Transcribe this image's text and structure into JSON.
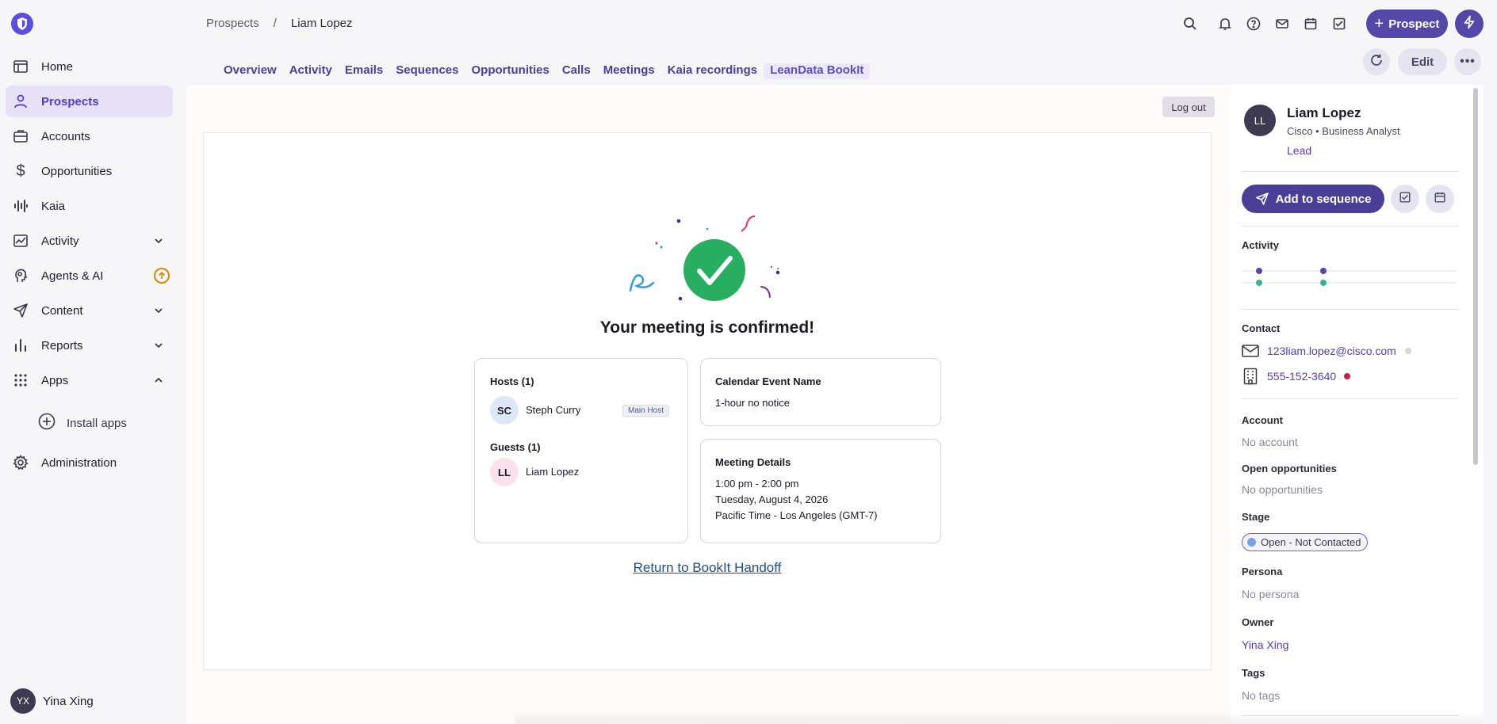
{
  "sidebar": {
    "items": [
      {
        "label": "Home",
        "icon": "home-icon"
      },
      {
        "label": "Prospects",
        "icon": "person-icon",
        "active": true
      },
      {
        "label": "Accounts",
        "icon": "briefcase-icon"
      },
      {
        "label": "Opportunities",
        "icon": "dollar-icon"
      },
      {
        "label": "Kaia",
        "icon": "waveform-icon"
      },
      {
        "label": "Activity",
        "icon": "activity-icon"
      },
      {
        "label": "Agents & AI",
        "icon": "agents-icon"
      },
      {
        "label": "Content",
        "icon": "send-icon"
      },
      {
        "label": "Reports",
        "icon": "bar-chart-icon"
      },
      {
        "label": "Apps",
        "icon": "grid-icon"
      }
    ],
    "install_apps": "Install apps",
    "administration": "Administration",
    "user": {
      "initials": "YX",
      "name": "Yina Xing"
    }
  },
  "breadcrumb": {
    "parent": "Prospects",
    "separator": "/",
    "current": "Liam Lopez"
  },
  "header": {
    "prospect_button": "Prospect"
  },
  "tabs": [
    "Overview",
    "Activity",
    "Emails",
    "Sequences",
    "Opportunities",
    "Calls",
    "Meetings",
    "Kaia recordings",
    "LeanData BookIt"
  ],
  "actions": {
    "edit": "Edit"
  },
  "bookit": {
    "logout": "Log out",
    "title": "Your meeting is confirmed!",
    "hosts_title": "Hosts (1)",
    "host": {
      "initials": "SC",
      "name": "Steph Curry",
      "badge": "Main Host"
    },
    "guests_title": "Guests (1)",
    "guest": {
      "initials": "LL",
      "name": "Liam Lopez"
    },
    "event_title": "Calendar Event Name",
    "event_name": "1-hour no notice",
    "details_title": "Meeting Details",
    "time": "1:00 pm - 2:00 pm",
    "date": "Tuesday, August 4, 2026",
    "timezone": "Pacific Time - Los Angeles (GMT-7)",
    "return_link": "Return to BookIt Handoff"
  },
  "profile": {
    "initials": "LL",
    "name": "Liam Lopez",
    "subtitle": "Cisco • Business Analyst",
    "type": "Lead",
    "add_to_sequence": "Add to sequence",
    "activity_label": "Activity",
    "contact_label": "Contact",
    "email": "123liam.lopez@cisco.com",
    "phone": "555-152-3640",
    "account_label": "Account",
    "account_value": "No account",
    "opps_label": "Open opportunities",
    "opps_value": "No opportunities",
    "stage_label": "Stage",
    "stage_value": "Open - Not Contacted",
    "persona_label": "Persona",
    "persona_value": "No persona",
    "owner_label": "Owner",
    "owner_value": "Yina Xing",
    "tags_label": "Tags",
    "tags_value": "No tags"
  },
  "colors": {
    "accent": "#5547a8",
    "success": "#27ae60",
    "link": "#4f3cc9"
  }
}
